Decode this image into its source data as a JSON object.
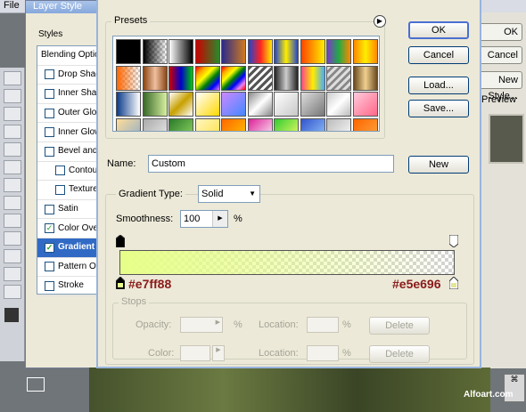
{
  "background": {
    "menu_file": "File",
    "layer_style": {
      "title": "Layer Style",
      "styles_header": "Styles",
      "items": [
        {
          "label": "Blending Options",
          "checkbox": false,
          "checked": false,
          "selected": false
        },
        {
          "label": "Drop Shadow",
          "checkbox": true,
          "checked": false,
          "selected": false
        },
        {
          "label": "Inner Shadow",
          "checkbox": true,
          "checked": false,
          "selected": false
        },
        {
          "label": "Outer Glow",
          "checkbox": true,
          "checked": false,
          "selected": false
        },
        {
          "label": "Inner Glow",
          "checkbox": true,
          "checked": false,
          "selected": false
        },
        {
          "label": "Bevel and Emboss",
          "checkbox": true,
          "checked": false,
          "selected": false
        },
        {
          "label": "Contour",
          "checkbox": true,
          "checked": false,
          "selected": false,
          "indent": true
        },
        {
          "label": "Texture",
          "checkbox": true,
          "checked": false,
          "selected": false,
          "indent": true
        },
        {
          "label": "Satin",
          "checkbox": true,
          "checked": false,
          "selected": false
        },
        {
          "label": "Color Overlay",
          "checkbox": true,
          "checked": true,
          "selected": false
        },
        {
          "label": "Gradient Overlay",
          "checkbox": true,
          "checked": true,
          "selected": true
        },
        {
          "label": "Pattern Overlay",
          "checkbox": true,
          "checked": false,
          "selected": false
        },
        {
          "label": "Stroke",
          "checkbox": true,
          "checked": false,
          "selected": false
        }
      ],
      "ghost_buttons": [
        "OK",
        "Cancel",
        "New Style...",
        "Preview"
      ]
    },
    "watermark": "Alfoart.com"
  },
  "gradient_editor": {
    "presets_label": "Presets",
    "ok_label": "OK",
    "cancel_label": "Cancel",
    "load_label": "Load...",
    "save_label": "Save...",
    "name_label": "Name:",
    "name_value": "Custom",
    "new_label": "New",
    "type_label": "Gradient Type:",
    "type_value": "Solid",
    "smoothness_label": "Smoothness:",
    "smoothness_value": "100",
    "smoothness_unit": "%",
    "start_color": "#e7ff88",
    "end_color": "#e5e696",
    "start_color_label": "#e7ff88",
    "end_color_label": "#e5e696",
    "stops": {
      "title": "Stops",
      "opacity_label": "Opacity:",
      "opacity_unit": "%",
      "location_label": "Location:",
      "location_unit": "%",
      "delete_label": "Delete",
      "color_label": "Color:"
    }
  },
  "presets_swatches": [
    "linear-gradient(90deg,#000,#000)",
    "linear-gradient(90deg,#000,rgba(0,0,0,0)),repeating-conic-gradient(#ccc 0 25%,#fff 0 50%) 0 0/6px 6px",
    "linear-gradient(90deg,#fff,#000)",
    "linear-gradient(90deg,#c00,#2a8a2a)",
    "linear-gradient(90deg,#2b2a8a,#d07a20)",
    "linear-gradient(90deg,#2244cc,#ff2222,#ffee00)",
    "linear-gradient(90deg,#2244cc,#ffee00,#2244cc)",
    "linear-gradient(90deg,#ff4400,#ffee00)",
    "linear-gradient(90deg,#7a3cc8,#22aa44,#ff8800)",
    "linear-gradient(90deg,#ff8800,#ffee00,#ff8800)",
    "linear-gradient(90deg,#ff6600,rgba(255,102,0,0)),repeating-conic-gradient(#ccc 0 25%,#fff 0 50%) 0 0/6px 6px",
    "linear-gradient(90deg,#8b4513,#f0c0a0,#8b4513)",
    "linear-gradient(90deg,#c00,#00c,#0c0)",
    "linear-gradient(135deg,red,orange,yellow,green,blue,violet)",
    "linear-gradient(135deg,red,orange,yellow,green,blue,violet,red)",
    "repeating-linear-gradient(135deg,#555 0 3px,#fff 3px 6px)",
    "linear-gradient(90deg,#222,#ccc,#222)",
    "linear-gradient(90deg,#ff4488,#ffee00,#44aaff)",
    "repeating-linear-gradient(135deg,#ddd 0 3px,#888 3px 6px)",
    "linear-gradient(90deg,#6b4a20,#f0d090,#6b4a20)",
    "linear-gradient(90deg,#0b3b8a,#fff)",
    "linear-gradient(90deg,#3a6a2a,#d8f0a0)",
    "linear-gradient(135deg,#fff,#c8a000,#fff)",
    "linear-gradient(135deg,#fff,#ffd800)",
    "linear-gradient(135deg,#cc88ff,#4488ff)",
    "linear-gradient(135deg,#888,#fff,#888)",
    "linear-gradient(135deg,#fff,#c8c8c8)",
    "linear-gradient(135deg,#ddd,#777)",
    "linear-gradient(135deg,#ccc,#fff,#bbb)",
    "linear-gradient(135deg,#ffccdd,#ff6688)",
    "linear-gradient(135deg,#ffdd99,#88aacc)",
    "linear-gradient(135deg,#aaa,#eee)",
    "linear-gradient(135deg,#2a7a2a,#99dd66)",
    "linear-gradient(135deg,#fff6c0,#ffe040)",
    "linear-gradient(135deg,#ff6600,#ffcc00)",
    "linear-gradient(135deg,#dd2299,#fff)",
    "linear-gradient(135deg,#33cc33,#ffff66)",
    "linear-gradient(135deg,#3355cc,#99ccff)",
    "linear-gradient(135deg,#bbb,#fff)",
    "linear-gradient(135deg,#ff6600,#ffaa44)",
    "linear-gradient(135deg,#55cc55,#009900)"
  ]
}
